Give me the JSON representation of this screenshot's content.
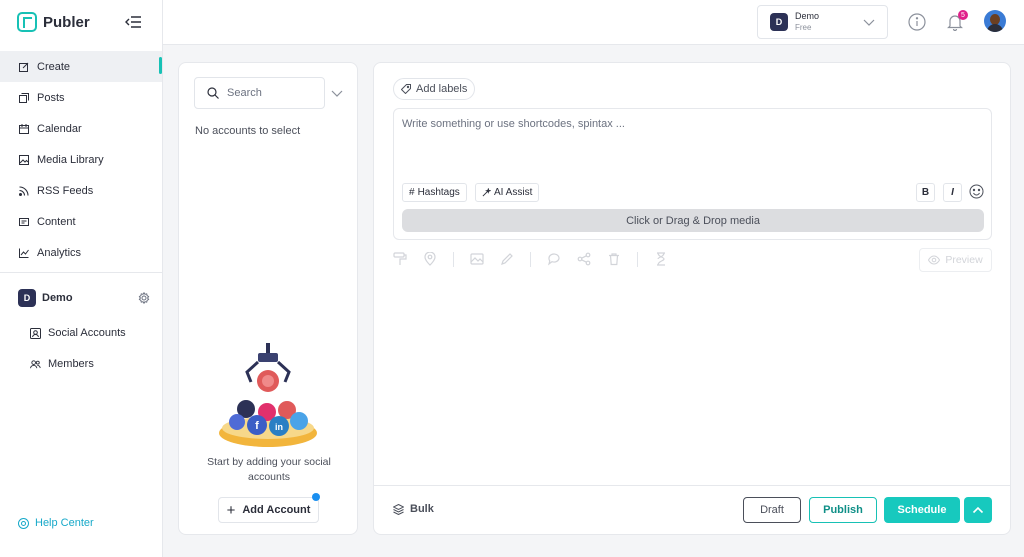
{
  "brand": {
    "name": "Publer",
    "accent": "#17c1b5"
  },
  "sidebar": {
    "items": [
      {
        "label": "Create",
        "icon": "edit-icon",
        "active": true
      },
      {
        "label": "Posts",
        "icon": "posts-icon"
      },
      {
        "label": "Calendar",
        "icon": "calendar-icon"
      },
      {
        "label": "Media Library",
        "icon": "image-icon"
      },
      {
        "label": "RSS Feeds",
        "icon": "rss-icon"
      },
      {
        "label": "Content",
        "icon": "content-icon"
      },
      {
        "label": "Analytics",
        "icon": "analytics-icon"
      }
    ],
    "workspace": {
      "initial": "D",
      "name": "Demo"
    },
    "sub_items": [
      {
        "label": "Social Accounts",
        "icon": "account-box-icon"
      },
      {
        "label": "Members",
        "icon": "members-icon"
      }
    ],
    "help": "Help Center"
  },
  "topbar": {
    "workspace_initial": "D",
    "workspace_name": "Demo",
    "workspace_plan": "Free",
    "notification_count": "5"
  },
  "accounts": {
    "search_placeholder": "Search",
    "empty": "No accounts to select",
    "start_text": "Start by adding your social accounts",
    "add_button": "Add Account"
  },
  "editor": {
    "add_labels": "Add labels",
    "placeholder": "Write something or use shortcodes, spintax ...",
    "hashtags": "Hashtags",
    "ai_assist": "AI Assist",
    "bold": "B",
    "italic": "I",
    "dropzone": "Click or Drag & Drop media",
    "preview": "Preview",
    "bulk": "Bulk",
    "draft": "Draft",
    "publish": "Publish",
    "schedule": "Schedule"
  }
}
